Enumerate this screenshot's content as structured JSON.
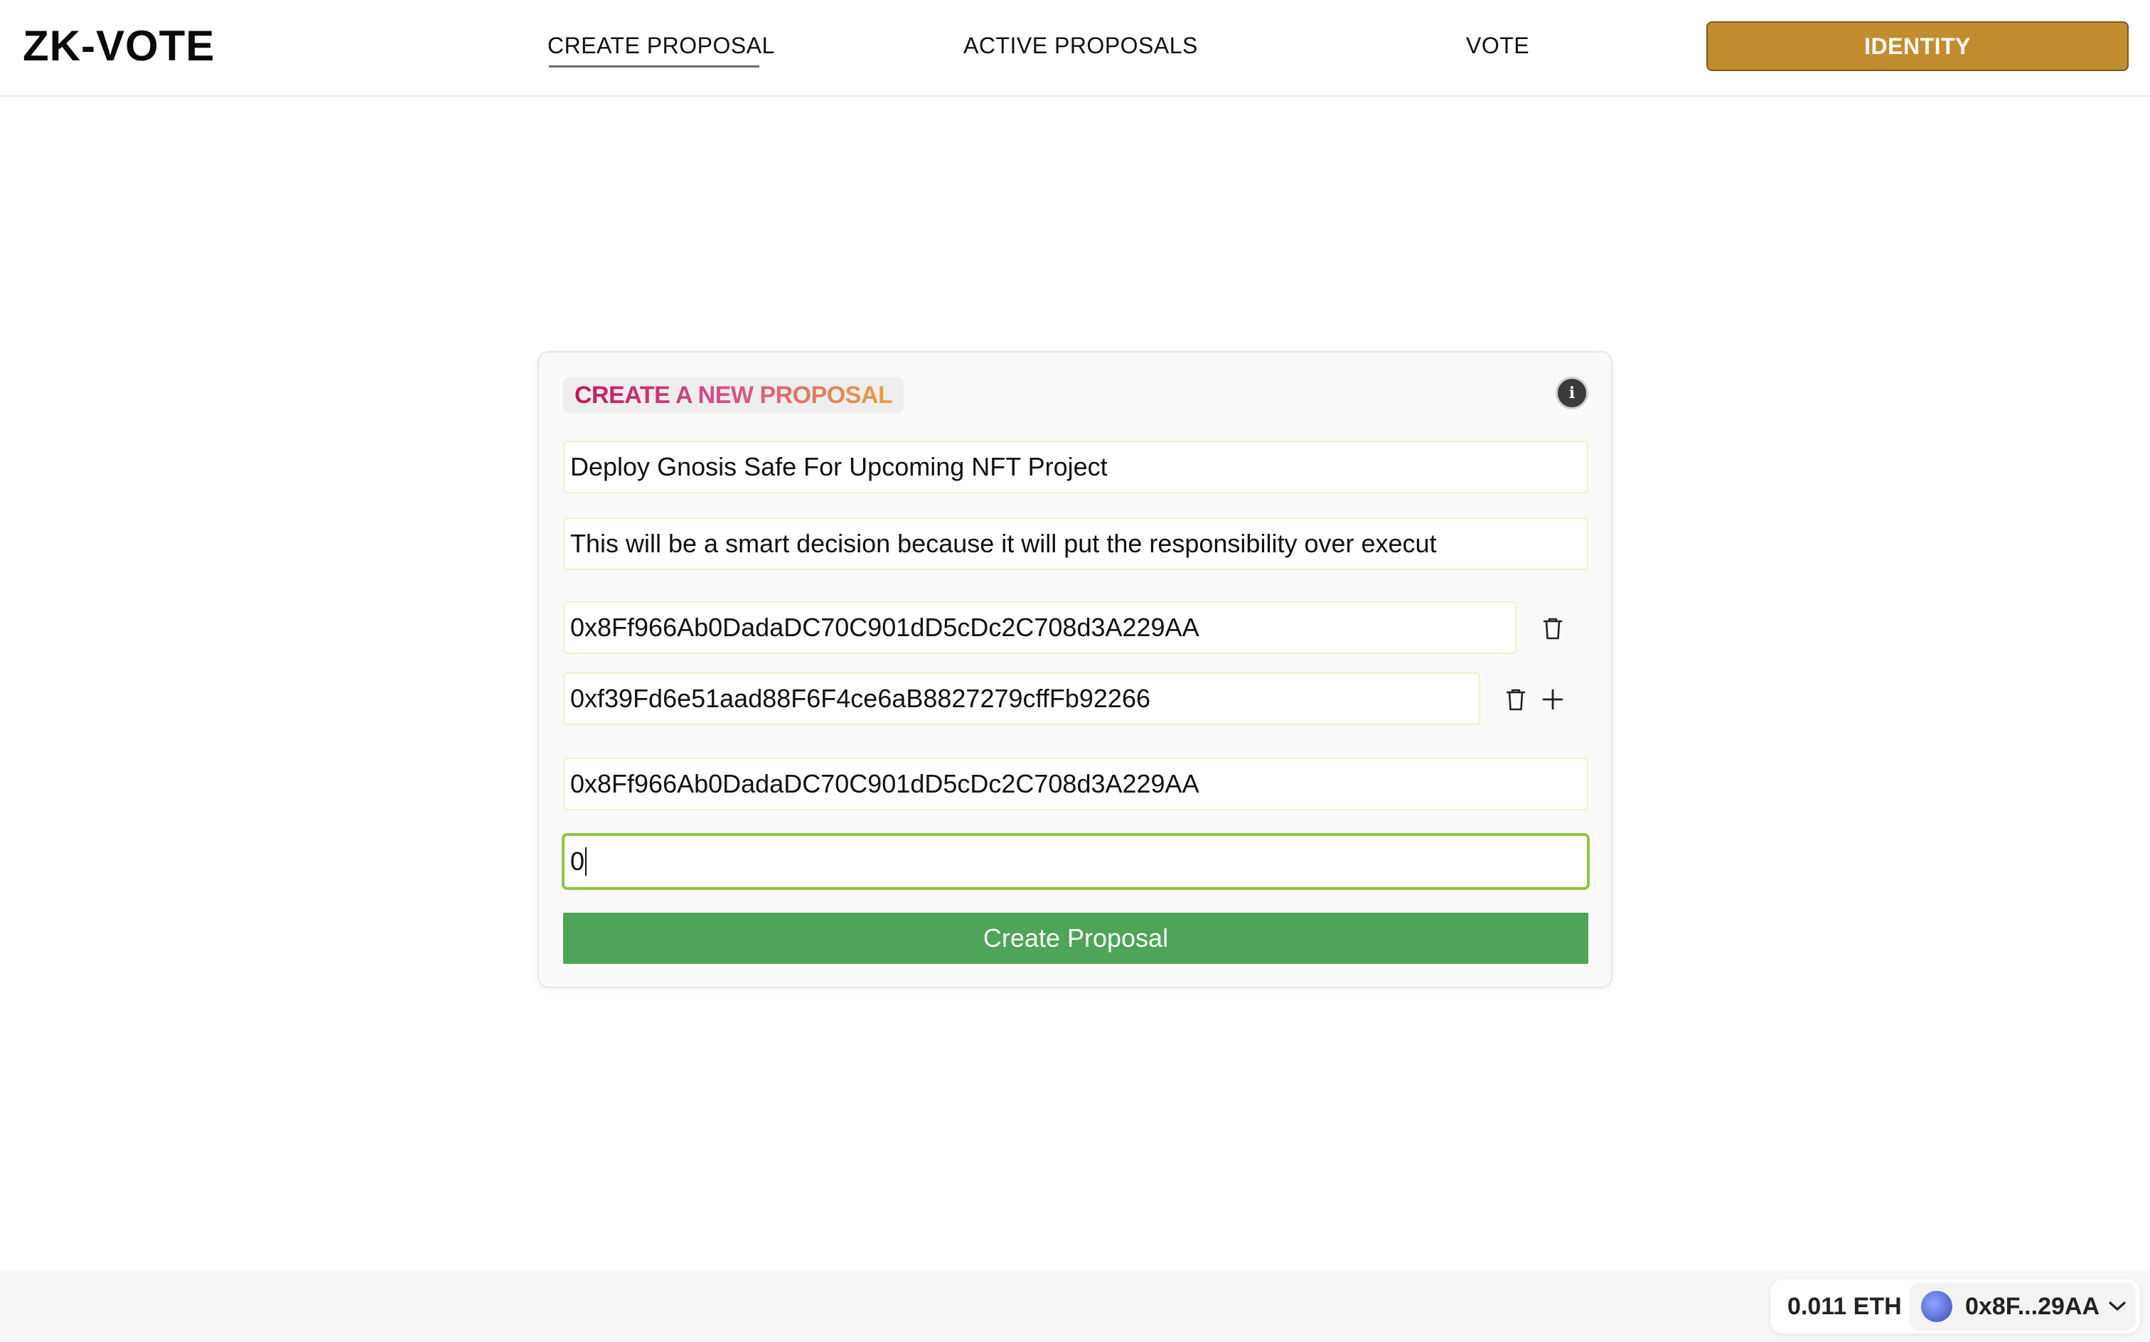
{
  "header": {
    "logo": "ZK-VOTE",
    "nav": {
      "create_proposal": "CREATE PROPOSAL",
      "active_proposals": "ACTIVE PROPOSALS",
      "vote": "VOTE"
    },
    "identity_button": "IDENTITY",
    "active_tab": "CREATE PROPOSAL"
  },
  "form": {
    "title": "CREATE A NEW PROPOSAL",
    "info_icon": "info-icon",
    "proposal_title": "Deploy Gnosis Safe For Upcoming NFT Project",
    "description": "This will be a smart decision because it will put the responsibility over execut",
    "addresses": [
      "0x8Ff966Ab0DadaDC70C901dD5cDc2C708d3A229AA",
      "0xf39Fd6e51aad88F6F4ce6aB8827279cffFb92266"
    ],
    "target_address": "0x8Ff966Ab0DadaDC70C901dD5cDc2C708d3A229AA",
    "value": "0",
    "submit_label": "Create Proposal"
  },
  "wallet": {
    "balance": "0.011 ETH",
    "account": "0x8F...29AA"
  },
  "colors": {
    "identity_button": "#c28d2f",
    "submit_button": "#4ea457",
    "focus_border": "#8cc63f"
  }
}
